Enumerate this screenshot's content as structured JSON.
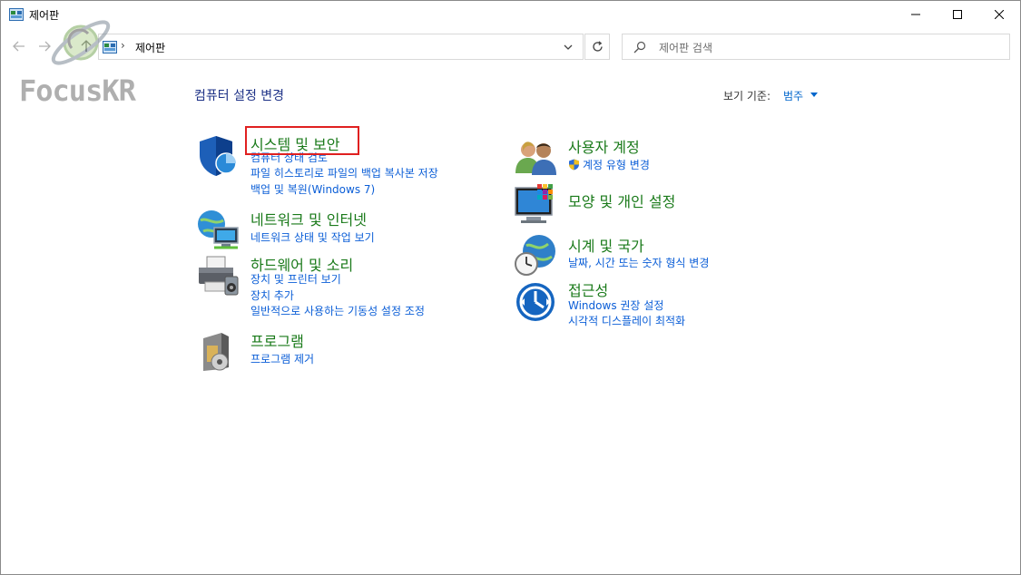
{
  "window": {
    "title": "제어판"
  },
  "address": {
    "path": "제어판",
    "separator": "›"
  },
  "search": {
    "placeholder": "제어판 검색"
  },
  "watermark": {
    "text": "FocusKR"
  },
  "header": {
    "title": "컴퓨터 설정 변경",
    "view_label": "보기 기준:",
    "view_value": "범주"
  },
  "categories": {
    "system": {
      "title": "시스템 및 보안",
      "links": [
        "컴퓨터 상태 검토",
        "파일 히스토리로 파일의 백업 복사본 저장",
        "백업 및 복원(Windows 7)"
      ]
    },
    "network": {
      "title": "네트워크 및 인터넷",
      "links": [
        "네트워크 상태 및 작업 보기"
      ]
    },
    "hardware": {
      "title": "하드웨어 및 소리",
      "links": [
        "장치 및 프린터 보기",
        "장치 추가",
        "일반적으로 사용하는 기동성 설정 조정"
      ]
    },
    "programs": {
      "title": "프로그램",
      "links": [
        "프로그램 제거"
      ]
    },
    "accounts": {
      "title": "사용자 계정",
      "links": [
        "계정 유형 변경"
      ]
    },
    "appearance": {
      "title": "모양 및 개인 설정",
      "links": []
    },
    "clock": {
      "title": "시계 및 국가",
      "links": [
        "날짜, 시간 또는 숫자 형식 변경"
      ]
    },
    "ease": {
      "title": "접근성",
      "links": [
        "Windows 권장 설정",
        "시각적 디스플레이 최적화"
      ]
    }
  },
  "colors": {
    "category_title": "#1a7a1a",
    "link": "#0b5ed7",
    "header_title": "#1e3287",
    "highlight": "#e02020"
  }
}
